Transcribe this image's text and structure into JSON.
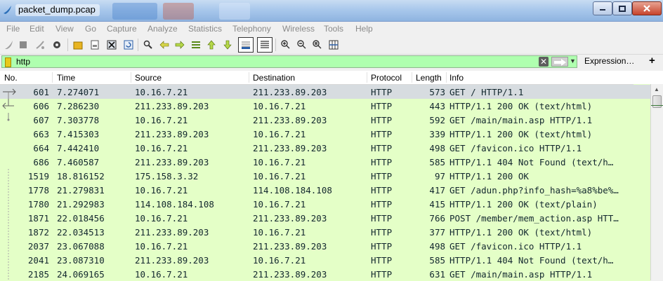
{
  "window": {
    "title": "packet_dump.pcap"
  },
  "menu": [
    "File",
    "Edit",
    "View",
    "Go",
    "Capture",
    "Analyze",
    "Statistics",
    "Telephony",
    "Wireless",
    "Tools",
    "Help"
  ],
  "filter": {
    "value": "http",
    "expression_label": "Expression…",
    "plus_label": "+"
  },
  "columns": [
    "No.",
    "Time",
    "Source",
    "Destination",
    "Protocol",
    "Length",
    "Info"
  ],
  "packets": [
    {
      "no": "601",
      "time": "7.274071",
      "src": "10.16.7.21",
      "dst": "211.233.89.203",
      "proto": "HTTP",
      "len": "573",
      "info": "GET / HTTP/1.1"
    },
    {
      "no": "606",
      "time": "7.286230",
      "src": "211.233.89.203",
      "dst": "10.16.7.21",
      "proto": "HTTP",
      "len": "443",
      "info": "HTTP/1.1 200 OK  (text/html)"
    },
    {
      "no": "607",
      "time": "7.303778",
      "src": "10.16.7.21",
      "dst": "211.233.89.203",
      "proto": "HTTP",
      "len": "592",
      "info": "GET /main/main.asp HTTP/1.1"
    },
    {
      "no": "663",
      "time": "7.415303",
      "src": "211.233.89.203",
      "dst": "10.16.7.21",
      "proto": "HTTP",
      "len": "339",
      "info": "HTTP/1.1 200 OK  (text/html)"
    },
    {
      "no": "664",
      "time": "7.442410",
      "src": "10.16.7.21",
      "dst": "211.233.89.203",
      "proto": "HTTP",
      "len": "498",
      "info": "GET /favicon.ico HTTP/1.1"
    },
    {
      "no": "686",
      "time": "7.460587",
      "src": "211.233.89.203",
      "dst": "10.16.7.21",
      "proto": "HTTP",
      "len": "585",
      "info": "HTTP/1.1 404 Not Found  (text/h…"
    },
    {
      "no": "1519",
      "time": "18.816152",
      "src": "175.158.3.32",
      "dst": "10.16.7.21",
      "proto": "HTTP",
      "len": "97",
      "info": "HTTP/1.1 200 OK"
    },
    {
      "no": "1778",
      "time": "21.279831",
      "src": "10.16.7.21",
      "dst": "114.108.184.108",
      "proto": "HTTP",
      "len": "417",
      "info": "GET /adun.php?info_hash=%a8%be%…"
    },
    {
      "no": "1780",
      "time": "21.292983",
      "src": "114.108.184.108",
      "dst": "10.16.7.21",
      "proto": "HTTP",
      "len": "415",
      "info": "HTTP/1.1 200 OK  (text/plain)"
    },
    {
      "no": "1871",
      "time": "22.018456",
      "src": "10.16.7.21",
      "dst": "211.233.89.203",
      "proto": "HTTP",
      "len": "766",
      "info": "POST /member/mem_action.asp HTT…"
    },
    {
      "no": "1872",
      "time": "22.034513",
      "src": "211.233.89.203",
      "dst": "10.16.7.21",
      "proto": "HTTP",
      "len": "377",
      "info": "HTTP/1.1 200 OK  (text/html)"
    },
    {
      "no": "2037",
      "time": "23.067088",
      "src": "10.16.7.21",
      "dst": "211.233.89.203",
      "proto": "HTTP",
      "len": "498",
      "info": "GET /favicon.ico HTTP/1.1"
    },
    {
      "no": "2041",
      "time": "23.087310",
      "src": "211.233.89.203",
      "dst": "10.16.7.21",
      "proto": "HTTP",
      "len": "585",
      "info": "HTTP/1.1 404 Not Found  (text/h…"
    },
    {
      "no": "2185",
      "time": "24.069165",
      "src": "10.16.7.21",
      "dst": "211.233.89.203",
      "proto": "HTTP",
      "len": "631",
      "info": "GET /main/main.asp HTTP/1.1"
    }
  ],
  "colors": {
    "row_bg": "#e4ffc7",
    "selected_bg": "#d7dce0",
    "filter_bg": "#afffaf"
  }
}
